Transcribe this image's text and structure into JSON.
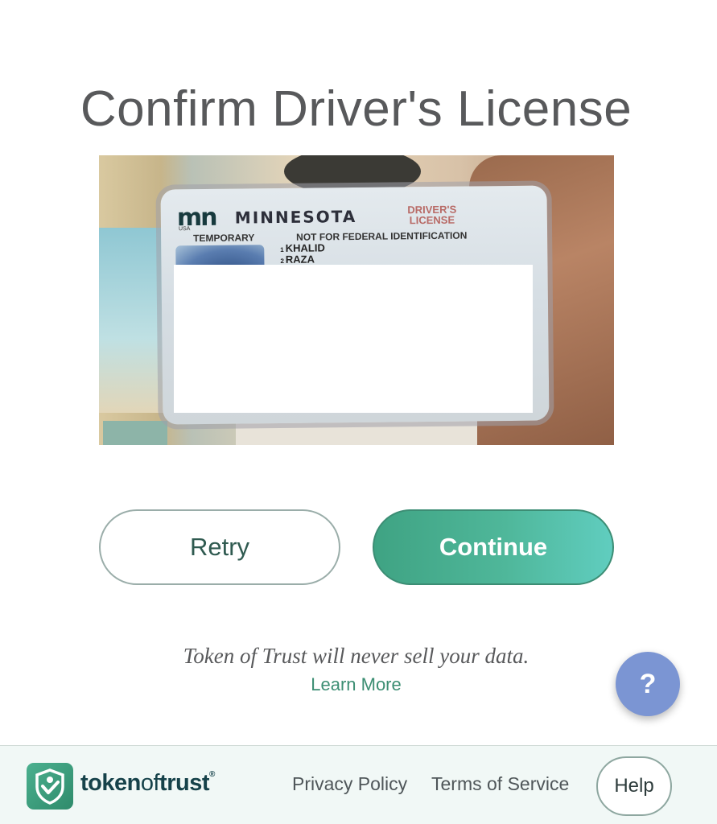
{
  "page": {
    "title": "Confirm Driver's License"
  },
  "license_card": {
    "state": "MINNESOTA",
    "logo_text": "mn",
    "logo_sub": "USA",
    "type_label": "DRIVER'S LICENSE",
    "temporary_label": "TEMPORARY",
    "notice": "NOT FOR FEDERAL IDENTIFICATION",
    "name_line_1_no": "1",
    "name_line_1": "KHALID",
    "name_line_2_no": "2",
    "name_line_2": "RAZA"
  },
  "actions": {
    "retry_label": "Retry",
    "continue_label": "Continue"
  },
  "privacy": {
    "statement": "Token of Trust will never sell your data.",
    "learn_more": "Learn More"
  },
  "help_fab": {
    "label": "?"
  },
  "footer": {
    "brand_part1": "token",
    "brand_part2": "of",
    "brand_part3": "trust",
    "brand_mark": "®",
    "privacy_policy": "Privacy Policy",
    "terms_of_service": "Terms of Service",
    "help": "Help"
  },
  "colors": {
    "accent_green": "#4fb79a",
    "help_fab_blue": "#7b95d3",
    "title_gray": "#58595b"
  }
}
